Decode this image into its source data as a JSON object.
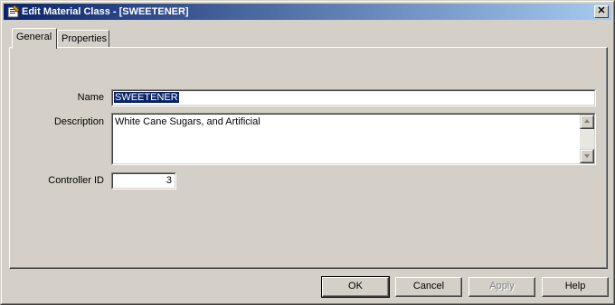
{
  "window": {
    "title": "Edit Material Class - [SWEETENER]",
    "close_glyph": "✕"
  },
  "tabs": [
    {
      "label": "General",
      "active": true
    },
    {
      "label": "Properties",
      "active": false
    }
  ],
  "form": {
    "name_label": "Name",
    "name_value": "SWEETENER",
    "description_label": "Description",
    "description_value": "White Cane Sugars, and Artificial",
    "controller_label": "Controller ID",
    "controller_value": "3"
  },
  "buttons": {
    "ok": "OK",
    "cancel": "Cancel",
    "apply": "Apply",
    "help": "Help"
  },
  "icons": {
    "title": "properties-icon",
    "close": "close-icon",
    "scroll_up": "scroll-up-icon",
    "scroll_down": "scroll-down-icon"
  },
  "colors": {
    "title_start": "#0a246a",
    "title_end": "#a6caf0",
    "face": "#d4d0c8",
    "selection": "#0a246a"
  }
}
